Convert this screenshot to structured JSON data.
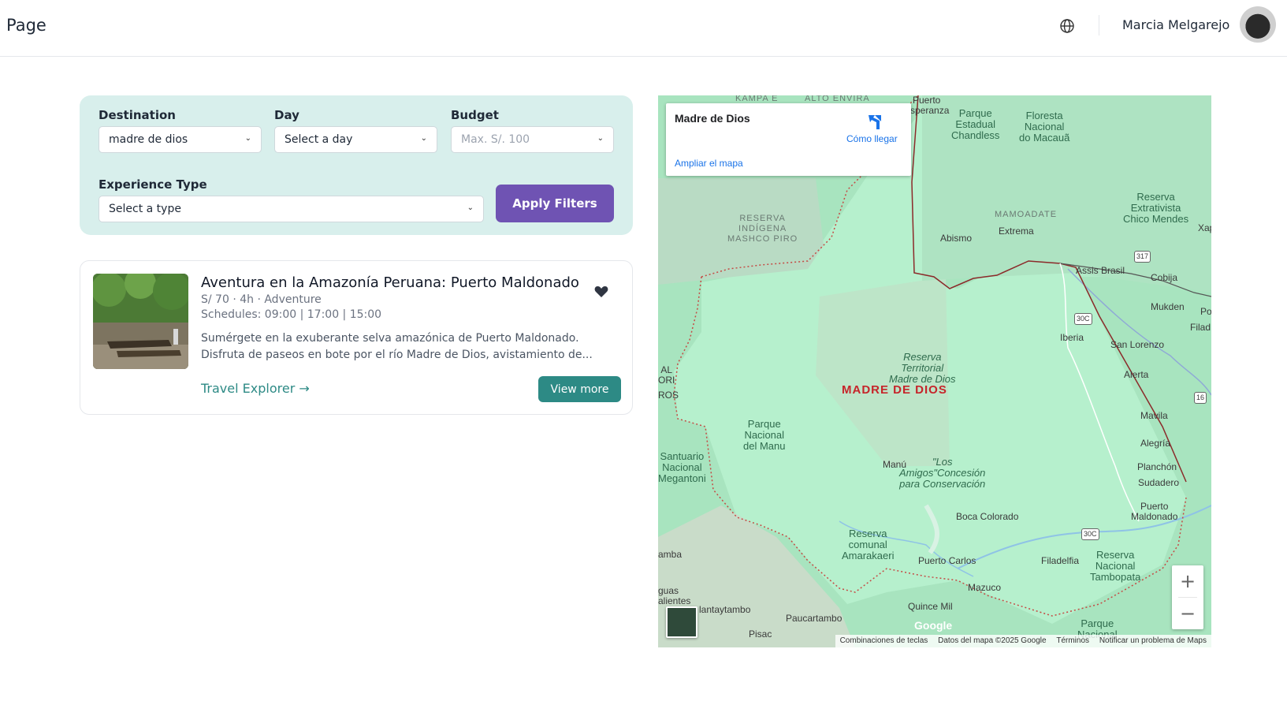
{
  "header": {
    "brand": "Page",
    "user_name": "Marcia Melgarejo"
  },
  "filters": {
    "destination": {
      "label": "Destination",
      "value": "madre de dios"
    },
    "day": {
      "label": "Day",
      "value": "Select a day"
    },
    "budget": {
      "label": "Budget",
      "placeholder": "Max. S/. 100"
    },
    "experience_type": {
      "label": "Experience Type",
      "value": "Select a type"
    },
    "apply_label": "Apply Filters"
  },
  "results": [
    {
      "title": "Aventura en la Amazonía Peruana: Puerto Maldonado",
      "meta": "S/ 70 · 4h · Adventure",
      "schedules": "Schedules: 09:00 | 17:00 | 15:00",
      "description": "Sumérgete en la exuberante selva amazónica de Puerto Maldonado. Disfruta de paseos en bote por el río Madre de Dios, avistamiento de...",
      "link_label": "Travel Explorer →",
      "button_label": "View more"
    }
  ],
  "map": {
    "place_card": {
      "title": "Madre de Dios",
      "directions_label": "Cómo llegar",
      "enlarge_label": "Ampliar el mapa"
    },
    "labels": {
      "kampa": "KAMPA E",
      "alto_envira": "ALTO ENVIRA",
      "puerto_esperanza": "Puerto\nEsperanza",
      "chandless": "Parque\nEstadual\nChandless",
      "macaua": "Floresta\nNacional\ndo Macauã",
      "mashco": "RESERVA\nINDÍGENA\nMASHCO PIRO",
      "mamoadate": "MAMOADATE",
      "abismo": "Abismo",
      "extrema": "Extrema",
      "chico_mendes": "Reserva\nExtrativista\nChico Mendes",
      "xap": "Xap",
      "assis": "Assis Brasil",
      "cobija": "Cobija",
      "mukden": "Mukden",
      "iberia": "Iberia",
      "san_lorenzo": "San Lorenzo",
      "filad": "Filad",
      "po": "Po",
      "reserva_territorial": "Reserva\nTerritorial\nMadre de Dios",
      "alerta": "Alerta",
      "region": "MADRE DE DIOS",
      "al_ori": "AL\nORI",
      "ros": "ROS",
      "manu_park": "Parque\nNacional\ndel Manu",
      "mavila": "Mavila",
      "alegria": "Alegría",
      "megantoni": "Santuario\nNacional\nMegantoni",
      "manu": "Manú",
      "los_amigos": "\"Los\nAmigos\"Concesión\npara Conservación",
      "planchon": "Planchón",
      "sudadero": "Sudadero",
      "puerto_maldonado": "Puerto\nMaldonado",
      "boca_colorado": "Boca Colorado",
      "amarakaeri": "Reserva\ncomunal\nAmarakaeri",
      "puerto_carlos": "Puerto Carlos",
      "filadelfia": "Filadelfia",
      "tambopata": "Reserva\nNacional\nTambopata",
      "amba": "amba",
      "aguas_calientes": "guas\nalientes",
      "mazuco": "Mazuco",
      "ollantaytambo": "lantaytambo",
      "quince_mil": "Quince Mil",
      "paucartambo": "Paucartambo",
      "pisac": "Pisac",
      "parque_nacional": "Parque\nNacional",
      "shield_317": "317",
      "shield_30c_a": "30C",
      "shield_30c_b": "30C",
      "shield_16": "16"
    },
    "google_logo": "Google",
    "attribution": {
      "shortcuts": "Combinaciones de teclas",
      "data": "Datos del mapa ©2025 Google",
      "terms": "Términos",
      "report": "Notificar un problema de Maps"
    },
    "zoom_in": "+",
    "zoom_out": "−"
  }
}
